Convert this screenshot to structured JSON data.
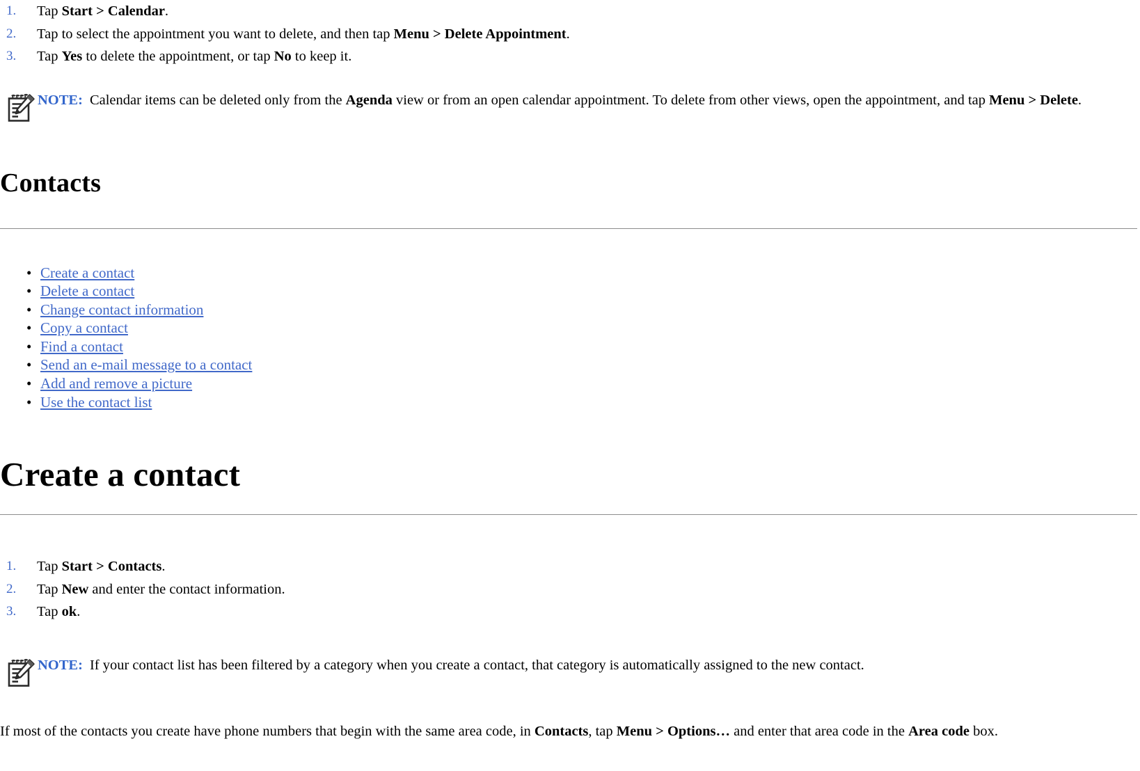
{
  "delete_appointment_steps": [
    {
      "marker": "1.",
      "parts": [
        {
          "t": "Tap ",
          "b": false
        },
        {
          "t": "Start > Calendar",
          "b": true
        },
        {
          "t": ".",
          "b": false
        }
      ]
    },
    {
      "marker": "2.",
      "parts": [
        {
          "t": "Tap to select the appointment you want to delete, and then tap ",
          "b": false
        },
        {
          "t": "Menu > Delete Appointment",
          "b": true
        },
        {
          "t": ".",
          "b": false
        }
      ]
    },
    {
      "marker": "3.",
      "parts": [
        {
          "t": "Tap ",
          "b": false
        },
        {
          "t": "Yes",
          "b": true
        },
        {
          "t": " to delete the appointment, or tap ",
          "b": false
        },
        {
          "t": "No",
          "b": true
        },
        {
          "t": " to keep it.",
          "b": false
        }
      ]
    }
  ],
  "note_calendar": {
    "icon": "note-pad-pencil-icon",
    "label": "NOTE:",
    "parts": [
      {
        "t": "Calendar items can be deleted only from the ",
        "b": false
      },
      {
        "t": "Agenda",
        "b": true
      },
      {
        "t": " view or from an open calendar appointment. To delete from other views, open the appointment, and tap ",
        "b": false
      },
      {
        "t": "Menu > Delete",
        "b": true
      },
      {
        "t": ".",
        "b": false
      }
    ]
  },
  "contacts_heading": "Contacts",
  "contacts_links": [
    "Create a contact",
    "Delete a contact",
    "Change contact information",
    "Copy a contact",
    "Find a contact",
    "Send an e-mail message to a contact",
    "Add and remove a picture",
    "Use the contact list"
  ],
  "create_contact_heading": "Create a contact",
  "create_contact_steps": [
    {
      "marker": "1.",
      "parts": [
        {
          "t": "Tap ",
          "b": false
        },
        {
          "t": "Start > ",
          "b": true
        },
        {
          "t": " ",
          "b": false
        },
        {
          "t": "Contacts",
          "b": true
        },
        {
          "t": ".",
          "b": false
        }
      ]
    },
    {
      "marker": "2.",
      "parts": [
        {
          "t": "Tap ",
          "b": false
        },
        {
          "t": "New",
          "b": true
        },
        {
          "t": " and enter the contact information.",
          "b": false
        }
      ]
    },
    {
      "marker": "3.",
      "parts": [
        {
          "t": "Tap ",
          "b": false
        },
        {
          "t": "ok",
          "b": true
        },
        {
          "t": ".",
          "b": false
        }
      ]
    }
  ],
  "note_contact": {
    "icon": "note-pad-pencil-icon",
    "label": "NOTE:",
    "parts": [
      {
        "t": "If your contact list has been filtered by a category when you create a contact, that category is automatically assigned to the new contact.",
        "b": false
      }
    ]
  },
  "area_code_paragraph": {
    "parts": [
      {
        "t": "If most of the contacts you create have phone numbers that begin with the same area code, in ",
        "b": false
      },
      {
        "t": "Contacts",
        "b": true
      },
      {
        "t": ", tap ",
        "b": false
      },
      {
        "t": "Menu > Options…",
        "b": true
      },
      {
        "t": " and enter that area code in the ",
        "b": false
      },
      {
        "t": "Area code",
        "b": true
      },
      {
        "t": " box.",
        "b": false
      }
    ]
  },
  "colors": {
    "link": "#4169c9",
    "note_label": "#3366cc",
    "list_marker": "#4169c9",
    "rule": "#8d8d8d",
    "text": "#000000"
  }
}
